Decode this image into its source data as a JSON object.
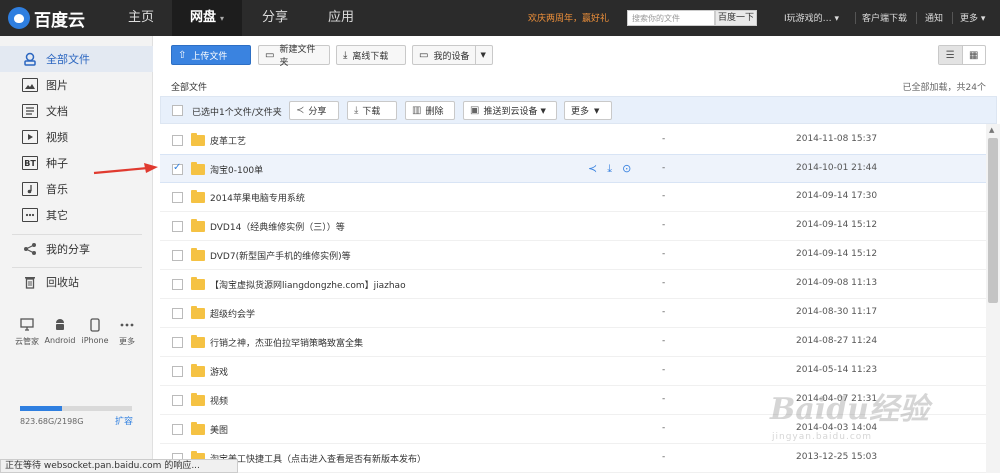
{
  "topbar": {
    "logo_text": "百度云",
    "nav": [
      {
        "label": "主页"
      },
      {
        "label": "网盘",
        "active": true
      },
      {
        "label": "分享"
      },
      {
        "label": "应用"
      }
    ],
    "caret": "▾",
    "promo": "欢庆两周年，赢好礼",
    "search_placeholder": "搜索你的文件",
    "search_button": "百度一下",
    "user": "I玩游戏的… ▾",
    "client_download": "客户端下载",
    "notice": "通知",
    "more": "更多 ▾"
  },
  "sidebar": {
    "items": [
      {
        "label": "全部文件",
        "icon": "all-files-icon",
        "active": true
      },
      {
        "label": "图片",
        "icon": "image-icon"
      },
      {
        "label": "文档",
        "icon": "document-icon"
      },
      {
        "label": "视频",
        "icon": "video-icon"
      },
      {
        "label": "种子",
        "icon": "torrent-icon",
        "glyph": "BT"
      },
      {
        "label": "音乐",
        "icon": "music-icon"
      },
      {
        "label": "其它",
        "icon": "other-icon"
      }
    ],
    "my_share": "我的分享",
    "recycle": "回收站",
    "devices": [
      {
        "label": "云管家",
        "icon": "monitor-icon"
      },
      {
        "label": "Android",
        "icon": "android-icon"
      },
      {
        "label": "iPhone",
        "icon": "iphone-icon"
      },
      {
        "label": "更多",
        "icon": "more-dots-icon"
      }
    ],
    "quota": {
      "text": "823.68G/2198G",
      "used_fraction": 0.375
    },
    "expand": "扩容"
  },
  "toolbar": {
    "upload": "上传文件",
    "new_folder": "新建文件夹",
    "offline_download": "离线下载",
    "my_devices": "我的设备"
  },
  "path": {
    "current": "全部文件",
    "loaded_info": "已全部加载，共24个"
  },
  "actionbar": {
    "selected_text": "已选中1个文件/文件夹",
    "share": "分享",
    "download": "下载",
    "delete": "删除",
    "push_to_device": "推送到云设备",
    "more": "更多"
  },
  "files": [
    {
      "name": "皮革工艺",
      "size": "-",
      "date": "2014-11-08 15:37",
      "selected": false
    },
    {
      "name": "淘宝0-100单",
      "size": "-",
      "date": "2014-10-01 21:44",
      "selected": true
    },
    {
      "name": "2014苹果电脑专用系统",
      "size": "-",
      "date": "2014-09-14 17:30",
      "selected": false
    },
    {
      "name": "DVD14（经典维修实例（三））等",
      "size": "-",
      "date": "2014-09-14 15:12",
      "selected": false
    },
    {
      "name": "DVD7(新型国产手机的维修实例)等",
      "size": "-",
      "date": "2014-09-14 15:12",
      "selected": false
    },
    {
      "name": "【淘宝虚拟货源网liangdongzhe.com】jiazhao",
      "size": "-",
      "date": "2014-09-08 11:13",
      "selected": false
    },
    {
      "name": "超级约会学",
      "size": "-",
      "date": "2014-08-30 11:17",
      "selected": false
    },
    {
      "name": "行销之神，杰亚伯拉罕销策略致富全集",
      "size": "-",
      "date": "2014-08-27 11:24",
      "selected": false
    },
    {
      "name": "游戏",
      "size": "-",
      "date": "2014-05-14 11:23",
      "selected": false
    },
    {
      "name": "视频",
      "size": "-",
      "date": "2014-04-07 21:31",
      "selected": false
    },
    {
      "name": "美图",
      "size": "-",
      "date": "2014-04-03 14:04",
      "selected": false
    },
    {
      "name": "淘宝美工快捷工具（点击进入查看是否有新版本发布）",
      "size": "-",
      "date": "2013-12-25 15:03",
      "selected": false
    }
  ],
  "status_bar": "正在等待 websocket.pan.baidu.com 的响应...",
  "watermark": {
    "brand": "Baidu经验",
    "url": "jingyan.baidu.com"
  },
  "colors": {
    "accent": "#3a83e0",
    "topbar": "#2b2b2b",
    "promo": "#f0913a",
    "folder": "#f5c243"
  }
}
